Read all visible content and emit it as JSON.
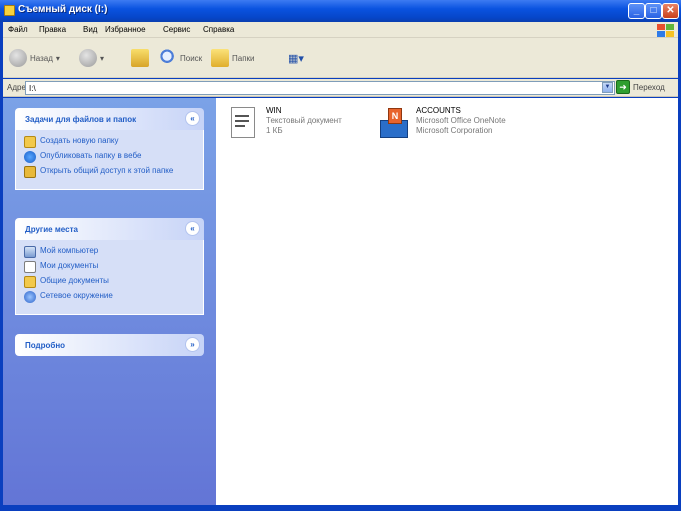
{
  "window": {
    "title": "Съемный диск (I:)",
    "controls": [
      "_",
      "□",
      "✕"
    ]
  },
  "menubar": {
    "items": [
      "Файл",
      "Правка",
      "Вид",
      "Избранное",
      "Сервис",
      "Справка"
    ]
  },
  "toolbar": {
    "back_label": "Назад",
    "forward_label": "",
    "up_label": "",
    "search_label": "Поиск",
    "folders_label": "Папки",
    "views_label": "▦▾"
  },
  "address": {
    "label": "Адрес",
    "value": "I:\\",
    "go_label": "Переход"
  },
  "taskpane": {
    "file_tasks": {
      "title": "Задачи для файлов и папок",
      "toggle": "«",
      "items": [
        {
          "label": "Создать новую папку",
          "icon": "new-folder-icon"
        },
        {
          "label": "Опубликовать папку в вебе",
          "icon": "publish-web-icon"
        },
        {
          "label": "Открыть общий доступ к этой папке",
          "icon": "share-folder-icon"
        }
      ]
    },
    "other_places": {
      "title": "Другие места",
      "toggle": "«",
      "items": [
        {
          "label": "Мой компьютер",
          "icon": "my-computer-icon"
        },
        {
          "label": "Мои документы",
          "icon": "my-documents-icon"
        },
        {
          "label": "Общие документы",
          "icon": "shared-documents-icon"
        },
        {
          "label": "Сетевое окружение",
          "icon": "network-places-icon"
        }
      ]
    },
    "details": {
      "title": "Подробно",
      "toggle": "»"
    }
  },
  "files": [
    {
      "name": "WIN",
      "line2": "Текстовый документ",
      "line3": "1 КБ",
      "icon": "text-document-icon"
    },
    {
      "name": "ACCOUNTS",
      "line2": "Microsoft Office OneNote",
      "line3": "Microsoft Corporation",
      "icon": "onenote-icon"
    }
  ],
  "colors": {
    "titlebar": "#0a53e0",
    "taskpane": "#6e8edf",
    "link": "#215dc6"
  }
}
